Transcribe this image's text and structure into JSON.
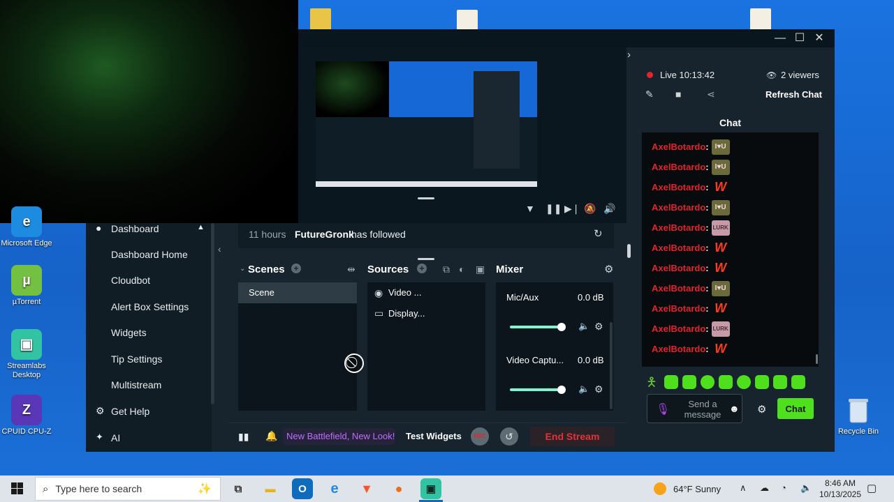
{
  "desktop": {
    "icons": [
      {
        "label": "Microsoft Edge",
        "glyph": "e",
        "color": "#1d8be0"
      },
      {
        "label": "µTorrent",
        "glyph": "µ",
        "color": "#74c043"
      },
      {
        "label": "Streamlabs Desktop",
        "glyph": "▣",
        "color": "#31c3a2"
      },
      {
        "label": "CPUID CPU-Z",
        "glyph": "Z",
        "color": "#5a37b7"
      }
    ],
    "recycle_bin": "Recycle Bin"
  },
  "window": {
    "min": "—",
    "max": "☐",
    "close": "✕"
  },
  "preview": {
    "controls": [
      "filter-icon",
      "pause-icon",
      "skip-icon",
      "mute-icon",
      "volume-icon"
    ]
  },
  "nav": {
    "dashboard": "Dashboard",
    "items": [
      "Dashboard Home",
      "Cloudbot",
      "Alert Box Settings",
      "Widgets",
      "Tip Settings",
      "Multistream"
    ],
    "get_help": "Get Help",
    "ai": "AI"
  },
  "events": {
    "time": "11 hours",
    "user": "FutureGronk",
    "action": "has followed"
  },
  "scenes": {
    "title": "Scenes",
    "items": [
      "Scene"
    ]
  },
  "sources": {
    "title": "Sources",
    "items": [
      "Video ...",
      "Display..."
    ]
  },
  "mixer": {
    "title": "Mixer",
    "channels": [
      {
        "name": "Mic/Aux",
        "level": "0.0 dB",
        "volume": 1.0
      },
      {
        "name": "Video Captu...",
        "level": "0.0 dB",
        "volume": 1.0
      }
    ]
  },
  "footer": {
    "promo": "New Battlefield, New Look!",
    "test_widgets": "Test Widgets",
    "rec": "REC",
    "end_stream": "End Stream"
  },
  "stream_info": {
    "live": "Live 10:13:42",
    "viewers": "2 viewers",
    "refresh": "Refresh Chat"
  },
  "chat": {
    "title": "Chat",
    "messages": [
      {
        "user": "AxelBotardo",
        "emote": "love"
      },
      {
        "user": "AxelBotardo",
        "emote": "love"
      },
      {
        "user": "AxelBotardo",
        "emote": "w"
      },
      {
        "user": "AxelBotardo",
        "emote": "love"
      },
      {
        "user": "AxelBotardo",
        "emote": "lurk"
      },
      {
        "user": "AxelBotardo",
        "emote": "w"
      },
      {
        "user": "AxelBotardo",
        "emote": "w"
      },
      {
        "user": "AxelBotardo",
        "emote": "love"
      },
      {
        "user": "AxelBotardo",
        "emote": "w"
      },
      {
        "user": "AxelBotardo",
        "emote": "lurk"
      },
      {
        "user": "AxelBotardo",
        "emote": "w"
      }
    ],
    "emote_love": "I♥U",
    "emote_w": "W",
    "emote_lurk": "LURK",
    "placeholder": "Send a message",
    "send": "Chat"
  },
  "taskbar": {
    "search_placeholder": "Type here to search",
    "weather": "64°F  Sunny",
    "time": "8:46 AM",
    "date": "10/13/2025"
  },
  "colors": {
    "accent": "#80f5d2",
    "chat_user": "#e3242b",
    "end_stream": "#e5323a",
    "chat_send": "#4fe01d"
  }
}
